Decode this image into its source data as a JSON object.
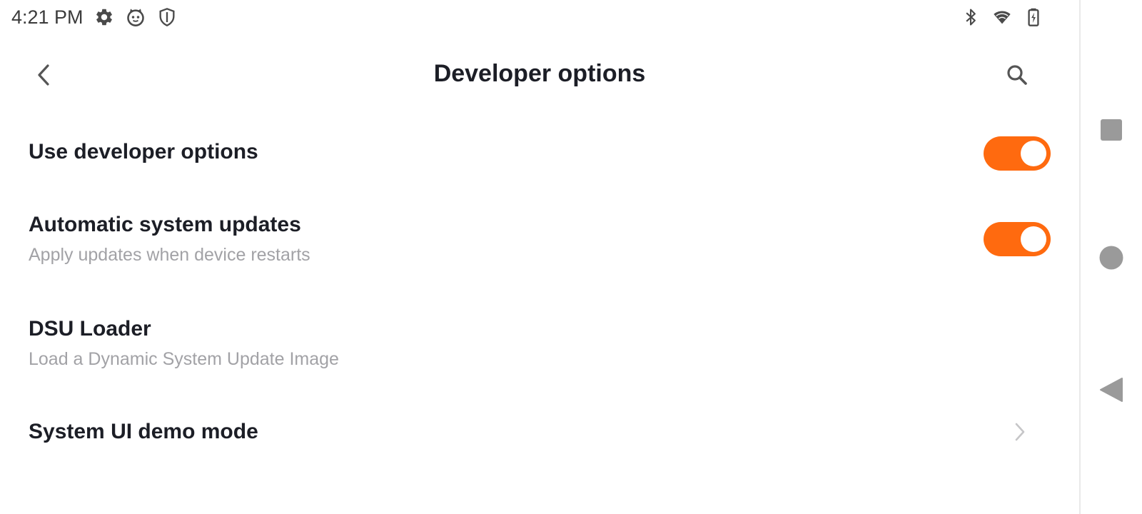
{
  "status_bar": {
    "time": "4:21 PM",
    "left_icons": [
      "gear-icon",
      "cat-face-icon",
      "shield-icon"
    ],
    "right_icons": [
      "bluetooth-icon",
      "wifi-icon",
      "battery-charging-icon"
    ]
  },
  "header": {
    "title": "Developer options",
    "back_icon": "chevron-left-icon",
    "search_icon": "search-icon"
  },
  "settings": [
    {
      "title": "Use developer options",
      "subtitle": "",
      "control": "toggle",
      "state": "on"
    },
    {
      "title": "Automatic system updates",
      "subtitle": "Apply updates when device restarts",
      "control": "toggle",
      "state": "on"
    },
    {
      "title": "DSU Loader",
      "subtitle": "Load a Dynamic System Update Image",
      "control": "none"
    },
    {
      "title": "System UI demo mode",
      "subtitle": "",
      "control": "chevron"
    }
  ],
  "nav_bar": {
    "buttons": [
      "recents-square-icon",
      "home-circle-icon",
      "back-triangle-icon"
    ]
  },
  "colors": {
    "accent": "#ff6a0f",
    "title_text": "#1c1e26",
    "subtitle_text": "#a2a2a6",
    "background": "#ffffff"
  }
}
